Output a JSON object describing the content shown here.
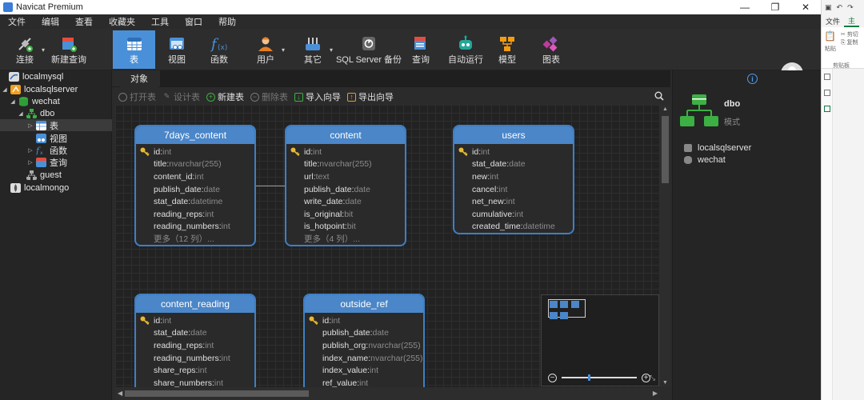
{
  "app": {
    "title": "Navicat Premium"
  },
  "window": {
    "minimize": "—",
    "maximize": "❐",
    "close": "✕"
  },
  "menu": [
    "文件",
    "编辑",
    "查看",
    "收藏夹",
    "工具",
    "窗口",
    "帮助"
  ],
  "toolbar": [
    {
      "label": "连接",
      "icon": "connect-icon",
      "dropdown": true
    },
    {
      "label": "新建查询",
      "icon": "new-query-icon"
    },
    {
      "label": "表",
      "icon": "table-icon",
      "active": true
    },
    {
      "label": "视图",
      "icon": "view-icon"
    },
    {
      "label": "函数",
      "icon": "function-icon"
    },
    {
      "label": "用户",
      "icon": "user-icon",
      "dropdown": true
    },
    {
      "label": "其它",
      "icon": "other-icon",
      "dropdown": true
    },
    {
      "label": "SQL Server 备份",
      "icon": "backup-icon"
    },
    {
      "label": "查询",
      "icon": "query-icon"
    },
    {
      "label": "自动运行",
      "icon": "automation-icon"
    },
    {
      "label": "模型",
      "icon": "model-icon"
    },
    {
      "label": "图表",
      "icon": "chart-icon"
    }
  ],
  "tree": [
    {
      "label": "localmysql",
      "icon": "mysql-connection-icon"
    },
    {
      "label": "localsqlserver",
      "icon": "sqlserver-connection-icon",
      "toggle": "◢"
    },
    {
      "label": "wechat",
      "icon": "database-icon",
      "toggle": "◢"
    },
    {
      "label": "dbo",
      "icon": "schema-icon",
      "toggle": "◢"
    },
    {
      "label": "表",
      "icon": "table-icon",
      "toggle": "▷",
      "selected": true
    },
    {
      "label": "视图",
      "icon": "view-icon"
    },
    {
      "label": "函数",
      "icon": "function-icon",
      "toggle": "▷"
    },
    {
      "label": "查询",
      "icon": "query-icon",
      "toggle": "▷"
    },
    {
      "label": "guest",
      "icon": "schema-icon"
    },
    {
      "label": "localmongo",
      "icon": "mongodb-connection-icon"
    }
  ],
  "tabs": {
    "object": "对象"
  },
  "objectbar": [
    {
      "label": "打开表",
      "icon": "open-table-icon",
      "enabled": false
    },
    {
      "label": "设计表",
      "icon": "design-table-icon",
      "enabled": false
    },
    {
      "label": "新建表",
      "icon": "new-table-icon",
      "enabled": true
    },
    {
      "label": "删除表",
      "icon": "delete-table-icon",
      "enabled": false
    },
    {
      "label": "导入向导",
      "icon": "import-wizard-icon",
      "enabled": true
    },
    {
      "label": "导出向导",
      "icon": "export-wizard-icon",
      "enabled": true
    }
  ],
  "tables": [
    {
      "name": "7days_content",
      "fields": [
        {
          "name": "id",
          "type": "int",
          "key": true
        },
        {
          "name": "title",
          "type": "nvarchar(255)"
        },
        {
          "name": "content_id",
          "type": "int"
        },
        {
          "name": "publish_date",
          "type": "date"
        },
        {
          "name": "stat_date",
          "type": "datetime"
        },
        {
          "name": "reading_reps",
          "type": "int"
        },
        {
          "name": "reading_numbers",
          "type": "int"
        }
      ],
      "more": "更多（12 列）..."
    },
    {
      "name": "content",
      "fields": [
        {
          "name": "id",
          "type": "int",
          "key": true
        },
        {
          "name": "title",
          "type": "nvarchar(255)"
        },
        {
          "name": "url",
          "type": "text"
        },
        {
          "name": "publish_date",
          "type": "date"
        },
        {
          "name": "write_date",
          "type": "date"
        },
        {
          "name": "is_original",
          "type": "bit"
        },
        {
          "name": "is_hotpoint",
          "type": "bit"
        }
      ],
      "more": "更多（4 列）..."
    },
    {
      "name": "users",
      "fields": [
        {
          "name": "id",
          "type": "int",
          "key": true
        },
        {
          "name": "stat_date",
          "type": "date"
        },
        {
          "name": "new",
          "type": "int"
        },
        {
          "name": "cancel",
          "type": "int"
        },
        {
          "name": "net_new",
          "type": "int"
        },
        {
          "name": "cumulative",
          "type": "int"
        },
        {
          "name": "created_time",
          "type": "datetime"
        }
      ],
      "more": ""
    },
    {
      "name": "content_reading",
      "fields": [
        {
          "name": "id",
          "type": "int",
          "key": true
        },
        {
          "name": "stat_date",
          "type": "date"
        },
        {
          "name": "reading_reps",
          "type": "int"
        },
        {
          "name": "reading_numbers",
          "type": "int"
        },
        {
          "name": "share_reps",
          "type": "int"
        },
        {
          "name": "share_numbers",
          "type": "int"
        }
      ],
      "more": ""
    },
    {
      "name": "outside_ref",
      "fields": [
        {
          "name": "id",
          "type": "int",
          "key": true
        },
        {
          "name": "publish_date",
          "type": "date"
        },
        {
          "name": "publish_org",
          "type": "nvarchar(255)"
        },
        {
          "name": "index_name",
          "type": "nvarchar(255)"
        },
        {
          "name": "index_value",
          "type": "int"
        },
        {
          "name": "ref_value",
          "type": "int"
        }
      ],
      "more": ""
    }
  ],
  "minimap": {
    "zoom_out": "−",
    "zoom_in": "+",
    "zoom_level": 0.35
  },
  "rightpanel": {
    "name": "dbo",
    "subtitle": "模式",
    "connection": "localsqlserver",
    "database": "wechat"
  },
  "office": {
    "tabs": [
      "文件",
      "主"
    ],
    "group": "剪贴板",
    "cut": "剪切",
    "copy": "复制",
    "paste": "粘贴"
  },
  "colors": {
    "accent": "#4a90d9",
    "card_header": "#4a86c8",
    "key": "#e8b931"
  }
}
